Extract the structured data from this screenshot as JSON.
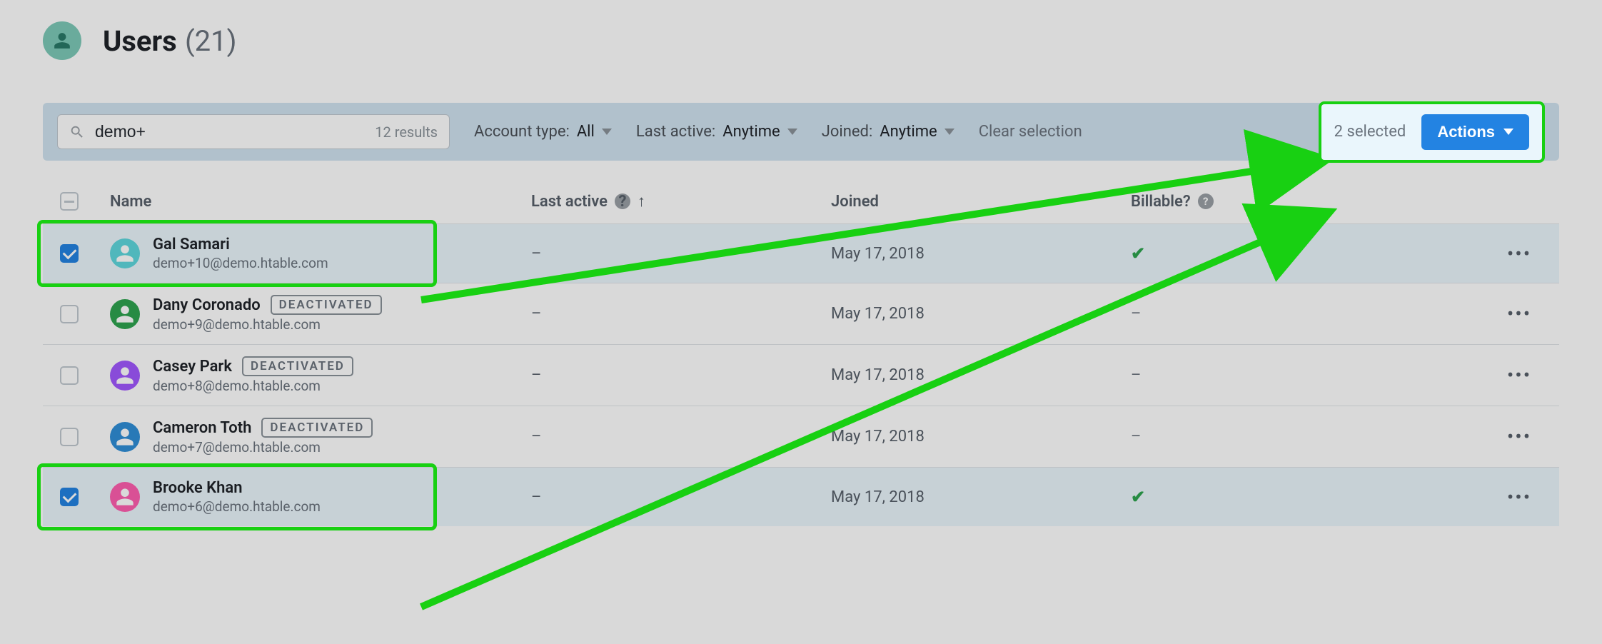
{
  "header": {
    "title": "Users",
    "count": "(21)"
  },
  "filters": {
    "search_value": "demo+",
    "search_results": "12 results",
    "account_type_label": "Account type:",
    "account_type_value": "All",
    "last_active_label": "Last active:",
    "last_active_value": "Anytime",
    "joined_label": "Joined:",
    "joined_value": "Anytime",
    "clear_selection": "Clear selection",
    "selected_label": "2 selected",
    "actions_label": "Actions"
  },
  "columns": {
    "name": "Name",
    "last_active": "Last active",
    "joined": "Joined",
    "billable": "Billable?"
  },
  "rows": [
    {
      "selected": true,
      "avatar_color": "#5fd7dd",
      "name": "Gal Samari",
      "email": "demo+10@demo.htable.com",
      "deactivated": false,
      "last_active": "–",
      "joined": "May 17, 2018",
      "billable": true
    },
    {
      "selected": false,
      "avatar_color": "#2ea44f",
      "name": "Dany Coronado",
      "email": "demo+9@demo.htable.com",
      "deactivated": true,
      "last_active": "–",
      "joined": "May 17, 2018",
      "billable": false
    },
    {
      "selected": false,
      "avatar_color": "#a259ff",
      "name": "Casey Park",
      "email": "demo+8@demo.htable.com",
      "deactivated": true,
      "last_active": "–",
      "joined": "May 17, 2018",
      "billable": false
    },
    {
      "selected": false,
      "avatar_color": "#2f8fd8",
      "name": "Cameron Toth",
      "email": "demo+7@demo.htable.com",
      "deactivated": true,
      "last_active": "–",
      "joined": "May 17, 2018",
      "billable": false
    },
    {
      "selected": true,
      "avatar_color": "#ff5fb0",
      "name": "Brooke Khan",
      "email": "demo+6@demo.htable.com",
      "deactivated": false,
      "last_active": "–",
      "joined": "May 17, 2018",
      "billable": true
    }
  ],
  "badge_text": "DEACTIVATED"
}
